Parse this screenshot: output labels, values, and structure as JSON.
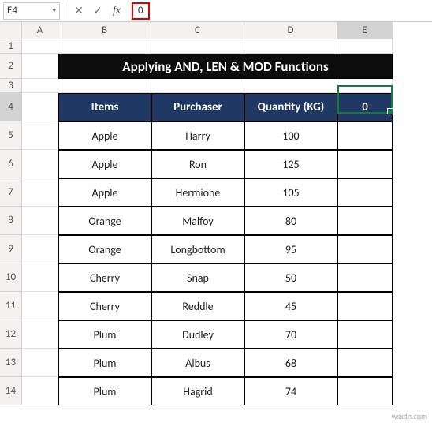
{
  "name_box": "E4",
  "formula_value": "0",
  "columns": [
    "A",
    "B",
    "C",
    "D",
    "E"
  ],
  "rows": [
    "1",
    "2",
    "3",
    "4",
    "5",
    "6",
    "7",
    "8",
    "9",
    "10",
    "11",
    "12",
    "13",
    "14"
  ],
  "title": "Applying AND, LEN & MOD Functions",
  "headers": {
    "items": "Items",
    "purchaser": "Purchaser",
    "quantity": "Quantity (KG)",
    "e": "0"
  },
  "data": [
    {
      "item": "Apple",
      "purchaser": "Harry",
      "qty": "100"
    },
    {
      "item": "Apple",
      "purchaser": "Ron",
      "qty": "125"
    },
    {
      "item": "Apple",
      "purchaser": "Hermione",
      "qty": "105"
    },
    {
      "item": "Orange",
      "purchaser": "Malfoy",
      "qty": "80"
    },
    {
      "item": "Orange",
      "purchaser": "Longbottom",
      "qty": "95"
    },
    {
      "item": "Cherry",
      "purchaser": "Snap",
      "qty": "50"
    },
    {
      "item": "Cherry",
      "purchaser": "Reddle",
      "qty": "45"
    },
    {
      "item": "Plum",
      "purchaser": "Dudley",
      "qty": "70"
    },
    {
      "item": "Plum",
      "purchaser": "Albus",
      "qty": "68"
    },
    {
      "item": "Plum",
      "purchaser": "Hagrid",
      "qty": "74"
    }
  ],
  "active_col": "E",
  "active_row": "4",
  "watermark": "wsxdn.com"
}
